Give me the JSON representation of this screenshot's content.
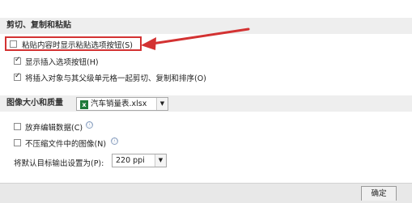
{
  "cut_copy_paste": {
    "header": "剪切、复制和粘贴",
    "options": [
      {
        "label": "粘贴内容时显示粘贴选项按钮(S)",
        "checked": false
      },
      {
        "label": "显示插入选项按钮(H)",
        "checked": true
      },
      {
        "label": "将插入对象与其父级单元格一起剪切、复制和排序(O)",
        "checked": true
      }
    ]
  },
  "image_size_quality": {
    "header": "图像大小和质量",
    "file_select": {
      "value": "汽车销量表.xlsx",
      "icon": "excel-file-icon"
    },
    "options": [
      {
        "label": "放弃编辑数据(C)",
        "checked": false,
        "info_icon": "ⓘ"
      },
      {
        "label": "不压缩文件中的图像(N)",
        "checked": false,
        "info_icon": "ⓘ"
      }
    ],
    "default_output_label": "将默认目标输出设置为(P):",
    "ppi_select": {
      "value": "220 ppi"
    }
  },
  "footer": {
    "ok_label": "确定"
  },
  "colors": {
    "highlight_border": "#d33232",
    "arrow": "#d33232"
  }
}
